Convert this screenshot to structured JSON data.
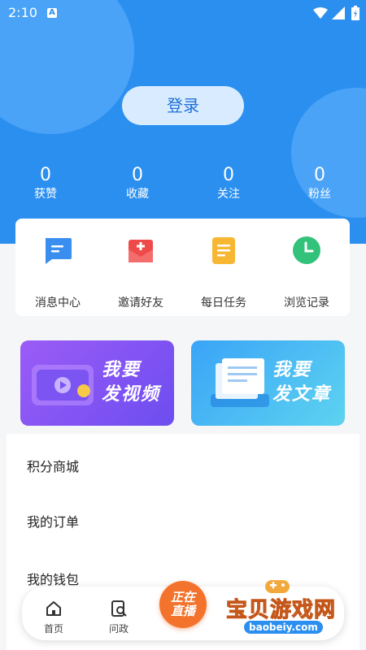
{
  "status_bar": {
    "time": "2:10",
    "a_badge": "A"
  },
  "login": {
    "label": "登录"
  },
  "stats": [
    {
      "value": "0",
      "label": "获赞"
    },
    {
      "value": "0",
      "label": "收藏"
    },
    {
      "value": "0",
      "label": "关注"
    },
    {
      "value": "0",
      "label": "粉丝"
    }
  ],
  "quick_actions": [
    {
      "label": "消息中心",
      "icon": "message-icon",
      "color": "#3a8ef0"
    },
    {
      "label": "邀请好友",
      "icon": "invite-icon",
      "color": "#ef4a4a"
    },
    {
      "label": "每日任务",
      "icon": "task-icon",
      "color": "#f7b733"
    },
    {
      "label": "浏览记录",
      "icon": "history-icon",
      "color": "#33c27a"
    }
  ],
  "banners": [
    {
      "line1": "我要",
      "line2": "发视频",
      "icon": "video-icon",
      "color": "#8b5cf6"
    },
    {
      "line1": "我要",
      "line2": "发文章",
      "icon": "article-icon",
      "color": "#2b9cf0"
    }
  ],
  "menu": [
    {
      "label": "积分商城"
    },
    {
      "label": "我的订单"
    },
    {
      "label": "我的钱包"
    }
  ],
  "tabbar": {
    "tabs": [
      {
        "label": "首页",
        "icon": "home-icon"
      },
      {
        "label": "问政",
        "icon": "inquiry-icon"
      }
    ],
    "live": {
      "line1": "正在",
      "line2": "直播"
    }
  },
  "watermark": {
    "text": "宝贝游戏网",
    "url": "baobeiy.com"
  }
}
